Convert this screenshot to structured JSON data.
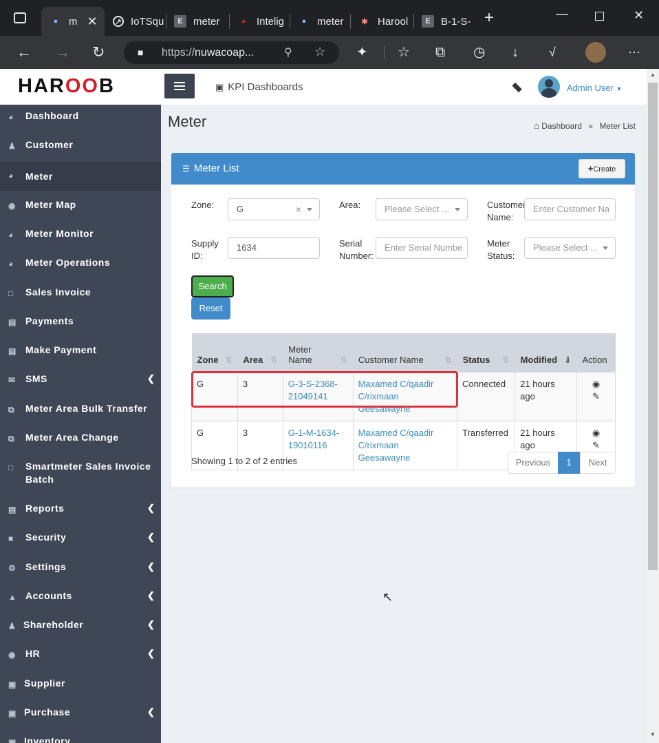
{
  "browser": {
    "tabs": [
      {
        "label": "m"
      },
      {
        "label": "IoTSqu"
      },
      {
        "label": "meter"
      },
      {
        "label": "Intelig"
      },
      {
        "label": "meter"
      },
      {
        "label": "Harool"
      },
      {
        "label": "B-1-S-"
      }
    ],
    "url_prefix": "https://",
    "url_host": "nuwacoap..."
  },
  "header": {
    "logo_left": "HAR",
    "logo_mid": "OO",
    "logo_right": "B",
    "kpi_label": "KPI Dashboards",
    "user_label": "Admin User"
  },
  "sidebar": {
    "items": [
      {
        "label": "Dashboard"
      },
      {
        "label": "Customer"
      },
      {
        "label": "Meter"
      },
      {
        "label": "Meter Map"
      },
      {
        "label": "Meter Monitor"
      },
      {
        "label": "Meter Operations"
      },
      {
        "label": "Sales Invoice"
      },
      {
        "label": "Payments"
      },
      {
        "label": "Make Payment"
      },
      {
        "label": "SMS"
      },
      {
        "label": "Meter Area Bulk Transfer"
      },
      {
        "label": "Meter Area Change"
      },
      {
        "label": "Smartmeter Sales Invoice"
      },
      {
        "label": "Batch"
      },
      {
        "label": "Reports"
      },
      {
        "label": "Security"
      },
      {
        "label": "Settings"
      },
      {
        "label": "Accounts"
      },
      {
        "label": "Shareholder"
      },
      {
        "label": "HR"
      },
      {
        "label": "Supplier"
      },
      {
        "label": "Purchase"
      },
      {
        "label": "Inventory"
      }
    ]
  },
  "page": {
    "title": "Meter",
    "breadcrumb_home": "Dashboard",
    "breadcrumb_current": "Meter List"
  },
  "box": {
    "title": "Meter List",
    "create_label": "Create"
  },
  "filters": {
    "zone_label": "Zone:",
    "zone_value": "G",
    "area_label": "Area:",
    "area_placeholder": "Please Select ...",
    "customer_label_1": "Customer",
    "customer_label_2": "Name:",
    "customer_placeholder": "Enter Customer Na",
    "supply_label_1": "Supply",
    "supply_label_2": "ID:",
    "supply_value": "1634",
    "serial_label_1": "Serial",
    "serial_label_2": "Number:",
    "serial_placeholder": "Enter Serial Numbe",
    "status_label_1": "Meter",
    "status_label_2": "Status:",
    "status_placeholder": "Please Select ...",
    "search_label": "Search",
    "reset_label": "Reset"
  },
  "table": {
    "columns": [
      "Zone",
      "Area",
      "Meter Name",
      "Customer Name",
      "Status",
      "Modified",
      "Action"
    ],
    "rows": [
      {
        "zone": "G",
        "area": "3",
        "meter_1": "G-3-S-2368-",
        "meter_2": "21049141",
        "cust_1": "Maxamed C/qaadir",
        "cust_2": "C/rixmaan Geesawayne",
        "status": "Connected",
        "modified": "21 hours ago"
      },
      {
        "zone": "G",
        "area": "3",
        "meter_1": "G-1-M-1634-",
        "meter_2": "19010116",
        "cust_1": "Maxamed C/qaadir",
        "cust_2": "C/rixmaan Geesawayne",
        "status": "Transferred",
        "modified": "21 hours ago"
      }
    ],
    "showing": "Showing 1 to 2 of 2 entries",
    "prev_label": "Previous",
    "page_label": "1",
    "next_label": "Next"
  },
  "colors": {
    "sidebar_bg": "#3f4655",
    "box_header": "#428bca",
    "search_green": "#4cae4c",
    "highlight_red": "#d9333b",
    "link_blue": "#3c8dbc"
  }
}
